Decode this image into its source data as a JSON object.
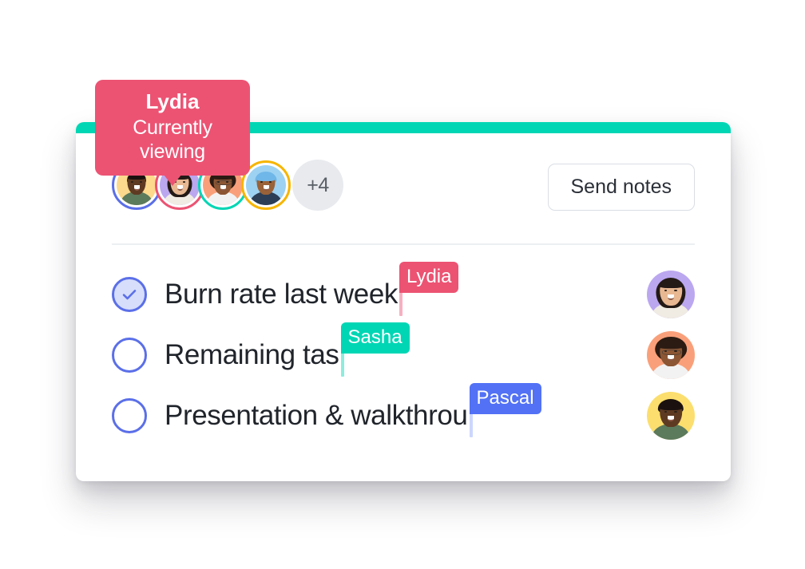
{
  "tooltip": {
    "name": "Lydia",
    "status": "Currently viewing",
    "color": "#EC5373"
  },
  "header": {
    "send_button_label": "Send notes",
    "overflow_badge_label": "+4",
    "viewers": [
      {
        "name": "viewer-1",
        "ring_color": "#5B6FE8",
        "bg": "#FCD98C",
        "skin": "#5E3A22",
        "hair": "#1b1210",
        "shirt": "#5C7A5C"
      },
      {
        "name": "viewer-2",
        "ring_color": "#EC5373",
        "bg": "#BBA7F0",
        "skin": "#E8B892",
        "hair": "#241a16",
        "shirt": "#F0EBE3"
      },
      {
        "name": "viewer-3",
        "ring_color": "#00D6B4",
        "bg": "#F9A07A",
        "skin": "#8C5634",
        "hair": "#2b1b13",
        "shirt": "#F2F2F2"
      },
      {
        "name": "viewer-4",
        "ring_color": "#F7B500",
        "bg": "#9ED2F2",
        "skin": "#9A6238",
        "hair": "#6FB7E8",
        "shirt": "#2C3E56"
      }
    ]
  },
  "tasks": [
    {
      "id": "task-burn-rate",
      "text": "Burn rate last week",
      "checked": true,
      "cursor": {
        "label": "Lydia",
        "color": "#EC5373",
        "caret_color": "#EC5373"
      },
      "assignee": {
        "name": "assignee-lydia",
        "bg": "#BBA7F0",
        "skin": "#E8B892",
        "hair": "#241a16",
        "shirt": "#F0EBE3"
      }
    },
    {
      "id": "task-remaining",
      "text": "Remaining tas",
      "checked": false,
      "cursor": {
        "label": "Sasha",
        "color": "#00D6B4",
        "caret_color": "#00D6B4"
      },
      "assignee": {
        "name": "assignee-sasha",
        "bg": "#F9A07A",
        "skin": "#8C5634",
        "hair": "#2b1b13",
        "shirt": "#F2F2F2"
      }
    },
    {
      "id": "task-presentation",
      "text": "Presentation & walkthrou",
      "checked": false,
      "cursor": {
        "label": "Pascal",
        "color": "#5271F5",
        "caret_color": "#8FA6F8"
      },
      "assignee": {
        "name": "assignee-pascal",
        "bg": "#FBDE6E",
        "skin": "#5E3A22",
        "hair": "#1b1210",
        "shirt": "#5C7A5C"
      }
    }
  ],
  "theme": {
    "accent_bar": "#00D6B4",
    "checkbox_border": "#5B6FE8",
    "checkbox_fill": "#D6DEFB",
    "divider": "#ECEFF2",
    "overflow_badge_bg": "#E8EAEE",
    "card_bg": "#FFFFFF"
  }
}
